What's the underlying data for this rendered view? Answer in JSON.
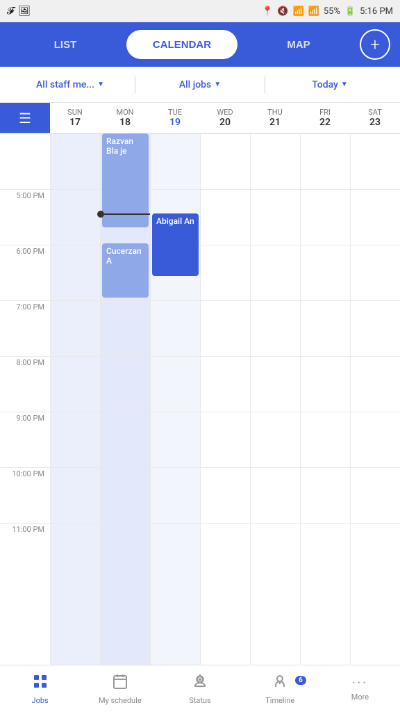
{
  "statusBar": {
    "battery": "55%",
    "time": "5:16 PM",
    "signal": "●●●●"
  },
  "topNav": {
    "tabs": [
      "LIST",
      "CALENDAR",
      "MAP"
    ],
    "activeTab": "CALENDAR",
    "addButton": "+"
  },
  "filters": {
    "staff": "All staff me...",
    "jobs": "All jobs",
    "date": "Today"
  },
  "calendar": {
    "days": [
      {
        "dow": "SUN",
        "num": "17",
        "today": false
      },
      {
        "dow": "MON",
        "num": "18",
        "today": false
      },
      {
        "dow": "TUE",
        "num": "19",
        "today": true
      },
      {
        "dow": "WED",
        "num": "20",
        "today": false
      },
      {
        "dow": "THU",
        "num": "21",
        "today": false
      },
      {
        "dow": "FRI",
        "num": "22",
        "today": false
      },
      {
        "dow": "SAT",
        "num": "23",
        "today": false
      }
    ],
    "timeSlots": [
      "5:00 PM",
      "6:00 PM",
      "7:00 PM",
      "8:00 PM",
      "9:00 PM",
      "10:00 PM",
      "11:00 PM"
    ],
    "events": [
      {
        "name": "Razvan Blaje",
        "col": 1,
        "topPx": 0,
        "heightPx": 130,
        "type": "light"
      },
      {
        "name": "Cucerzan A",
        "col": 1,
        "topPx": 160,
        "heightPx": 80,
        "type": "light"
      },
      {
        "name": "Abigail An",
        "col": 2,
        "topPx": 95,
        "heightPx": 80,
        "type": "dark"
      }
    ]
  },
  "bottomNav": {
    "items": [
      {
        "label": "Jobs",
        "icon": "grid",
        "active": true
      },
      {
        "label": "My schedule",
        "icon": "calendar",
        "active": false
      },
      {
        "label": "Status",
        "icon": "pin",
        "active": false
      },
      {
        "label": "Timeline",
        "icon": "person",
        "active": false,
        "badge": "6"
      },
      {
        "label": "More",
        "icon": "dots",
        "active": false
      }
    ]
  }
}
